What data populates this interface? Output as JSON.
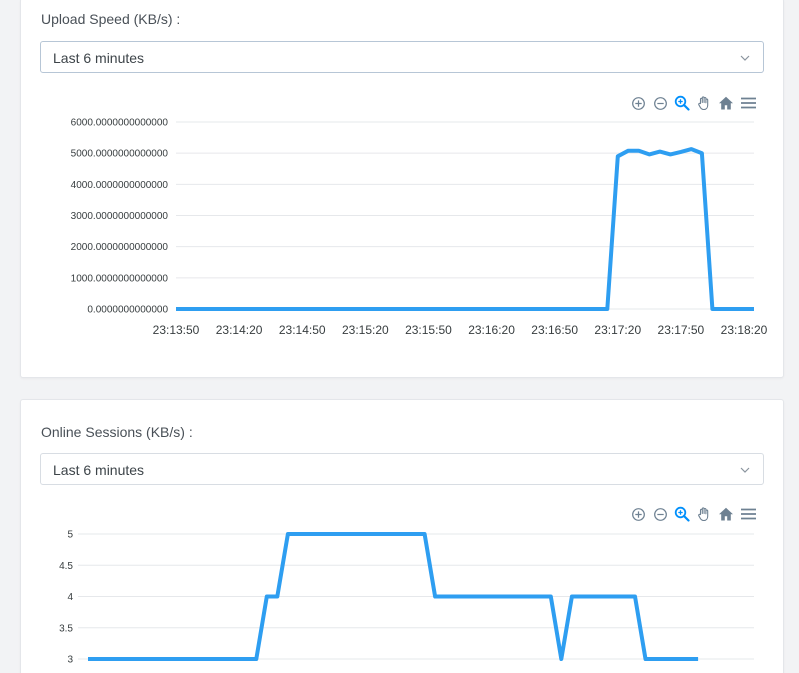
{
  "colors": {
    "series": "#2e9ef1",
    "toolbar_icon": "#6e8192",
    "toolbar_icon_active": "#008ffb"
  },
  "upload_card": {
    "title": "Upload Speed (KB/s) :",
    "range_select": {
      "value": "Last 6 minutes",
      "icon": "chevron-down-icon"
    },
    "toolbar": [
      {
        "name": "zoom-in-icon",
        "active": false
      },
      {
        "name": "zoom-out-icon",
        "active": false
      },
      {
        "name": "selection-zoom-icon",
        "active": true
      },
      {
        "name": "pan-hand-icon",
        "active": false
      },
      {
        "name": "reset-home-icon",
        "active": false
      },
      {
        "name": "menu-icon",
        "active": false
      }
    ],
    "chart_data": {
      "type": "line",
      "x_ticks": [
        "23:13:50",
        "23:14:20",
        "23:14:50",
        "23:15:20",
        "23:15:50",
        "23:16:20",
        "23:16:50",
        "23:17:20",
        "23:17:50",
        "23:18:20"
      ],
      "y_ticks": [
        "6000.0000000000000",
        "5000.0000000000000",
        "4000.0000000000000",
        "3000.0000000000000",
        "2000.0000000000000",
        "1000.0000000000000",
        "0.0000000000000"
      ],
      "ylim": [
        0,
        6000
      ],
      "grid": true,
      "legend": "none",
      "series": [
        {
          "points": [
            [
              "23:13:50",
              0
            ],
            [
              "23:17:15",
              0
            ],
            [
              "23:17:20",
              4900
            ],
            [
              "23:17:25",
              5080
            ],
            [
              "23:17:30",
              5080
            ],
            [
              "23:17:35",
              4960
            ],
            [
              "23:17:40",
              5050
            ],
            [
              "23:17:45",
              4960
            ],
            [
              "23:17:50",
              5040
            ],
            [
              "23:17:55",
              5130
            ],
            [
              "23:18:00",
              5000
            ],
            [
              "23:18:05",
              0
            ],
            [
              "23:18:40",
              0
            ]
          ]
        }
      ]
    }
  },
  "sessions_card": {
    "title": "Online Sessions (KB/s) :",
    "range_select": {
      "value": "Last 6 minutes",
      "icon": "chevron-down-icon"
    },
    "toolbar": [
      {
        "name": "zoom-in-icon",
        "active": false
      },
      {
        "name": "zoom-out-icon",
        "active": false
      },
      {
        "name": "selection-zoom-icon",
        "active": true
      },
      {
        "name": "pan-hand-icon",
        "active": false
      },
      {
        "name": "reset-home-icon",
        "active": false
      },
      {
        "name": "menu-icon",
        "active": false
      }
    ],
    "chart_data": {
      "type": "line",
      "y_ticks": [
        "5",
        "4.5",
        "4",
        "3.5",
        "3"
      ],
      "ylim": [
        3,
        5
      ],
      "grid": true,
      "legend": "none",
      "series": [
        {
          "points": [
            [
              "23:13:50",
              3
            ],
            [
              "23:15:10",
              3
            ],
            [
              "23:15:15",
              4
            ],
            [
              "23:15:20",
              4
            ],
            [
              "23:15:25",
              5
            ],
            [
              "23:16:30",
              5
            ],
            [
              "23:16:35",
              4
            ],
            [
              "23:17:30",
              4
            ],
            [
              "23:17:35",
              3
            ],
            [
              "23:17:40",
              4
            ],
            [
              "23:18:10",
              4
            ],
            [
              "23:18:15",
              3
            ],
            [
              "23:18:40",
              3
            ]
          ]
        }
      ]
    }
  }
}
